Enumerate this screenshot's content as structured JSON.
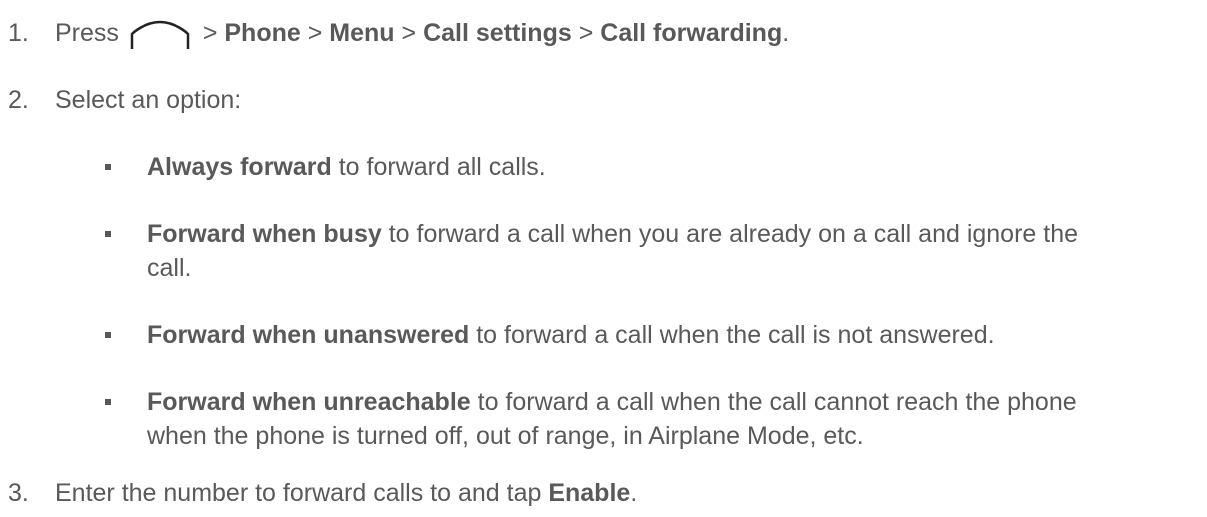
{
  "steps": [
    {
      "number": "1.",
      "parts": [
        "Press",
        ">",
        "Phone",
        ">",
        "Menu",
        ">",
        "Call settings",
        ">",
        "Call forwarding",
        "."
      ],
      "icon": "home-icon"
    },
    {
      "number": "2.",
      "text": "Select an option:"
    },
    {
      "number": "3.",
      "prefix": "Enter the number to forward calls to and tap ",
      "bold": "Enable",
      "suffix": "."
    }
  ],
  "options": [
    {
      "bold": "Always forward",
      "text": " to forward all calls."
    },
    {
      "bold": "Forward when busy",
      "text": " to forward a call when you are already on a call and ignore the",
      "cont": "call."
    },
    {
      "bold": "Forward when unanswered",
      "text": " to forward a call when the call is not answered."
    },
    {
      "bold": "Forward when unreachable",
      "text": " to forward a call when the call cannot reach the phone",
      "cont": "when the phone is turned off, out of range, in Airplane Mode, etc."
    }
  ]
}
